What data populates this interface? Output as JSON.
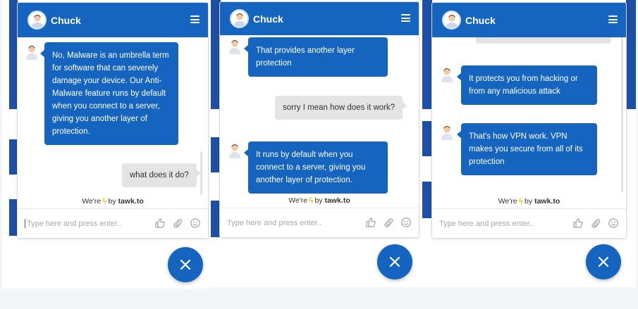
{
  "colors": {
    "brand_blue": "#1565c0",
    "user_bubble": "#e4e4e4",
    "bolt": "#f6c026"
  },
  "panels": [
    {
      "agent_name": "Chuck",
      "messages": [
        {
          "from": "agent",
          "text": "No, Malware is an umbrella term for software that can severely damage your device. Our Anti-Malware feature runs by default when you connect to a server, giving you another layer of protection."
        },
        {
          "from": "user",
          "text": "what does it do?"
        }
      ],
      "powered_prefix": "We're",
      "powered_by": "by",
      "powered_brand": "tawk.to",
      "input_placeholder": "Type here and press enter.."
    },
    {
      "agent_name": "Chuck",
      "messages": [
        {
          "from": "agent",
          "text": "That provides another layer protection"
        },
        {
          "from": "user",
          "text": "sorry I mean how does it work?"
        },
        {
          "from": "agent",
          "text": "It runs by default when you connect to a server, giving you another layer of protection."
        }
      ],
      "powered_prefix": "We're",
      "powered_by": "by",
      "powered_brand": "tawk.to",
      "input_placeholder": "Type here and press enter.."
    },
    {
      "agent_name": "Chuck",
      "messages": [
        {
          "from": "agent",
          "text": "It protects you from hacking or from any malicious attack"
        },
        {
          "from": "agent",
          "text": "That's how VPN work. VPN makes you secure from all of its protection"
        }
      ],
      "powered_prefix": "We're",
      "powered_by": "by",
      "powered_brand": "tawk.to",
      "input_placeholder": "Type here and press enter.."
    }
  ],
  "icons": [
    "agent-avatar-icon",
    "menu-icon",
    "thumbs-up-icon",
    "paperclip-icon",
    "smiley-icon",
    "close-icon",
    "lightning-icon"
  ]
}
